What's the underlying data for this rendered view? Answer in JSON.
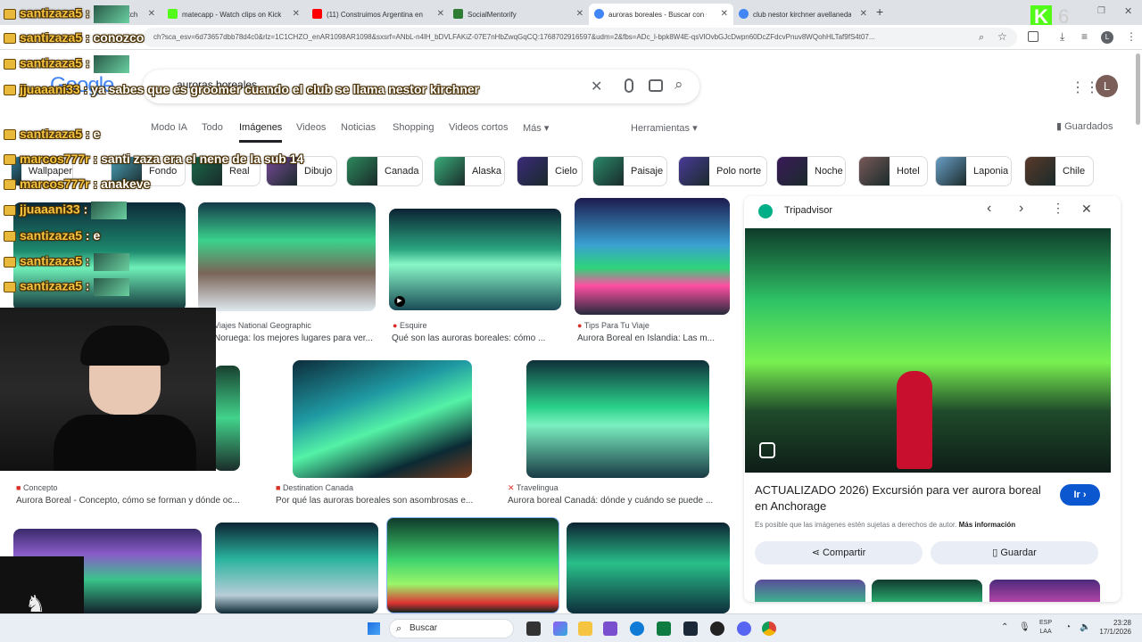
{
  "browser": {
    "tabs": [
      {
        "label": "Watch",
        "fav": "#ff9900",
        "active": false
      },
      {
        "label": "matecapp - Watch clips on Kick",
        "fav": "#53fc18",
        "active": false
      },
      {
        "label": "(11) Construimos Argentina en",
        "fav": "#ff0000",
        "active": false
      },
      {
        "label": "SocialMentorify",
        "fav": "#2e7d32",
        "active": false
      },
      {
        "label": "auroras boreales - Buscar con G",
        "fav": "#4285f4",
        "active": true
      },
      {
        "label": "club nestor kirchner avellaneda",
        "fav": "#4285f4",
        "active": false
      }
    ],
    "new_tab": "+",
    "url": "ch?sca_esv=6d73657dbb78d4c0&rlz=1C1CHZO_enAR1098AR1098&sxsrf=ANbL-n4lH_bDVLFAKiZ-07E7nHbZwqGqCQ:1768702916597&udm=2&fbs=ADc_l-bpk8W4E-qsVlOvbGJcDwpn60DcZFdcvPnuv8WQohHLTaf9fS4t07...",
    "kick_badge": "K",
    "kick_count": "6"
  },
  "search": {
    "logo": "Google",
    "query": "auroras boreales",
    "avatar_letter": "L",
    "nav": [
      {
        "label": "Modo IA",
        "active": false
      },
      {
        "label": "Todo",
        "active": false
      },
      {
        "label": "Imágenes",
        "active": true
      },
      {
        "label": "Videos",
        "active": false
      },
      {
        "label": "Noticias",
        "active": false
      },
      {
        "label": "Shopping",
        "active": false
      },
      {
        "label": "Videos cortos",
        "active": false
      },
      {
        "label": "Más ▾",
        "active": false
      }
    ],
    "tools": "Herramientas ▾",
    "saved": "Guardados",
    "chips": [
      "Wallpaper",
      "Fondo",
      "Real",
      "Dibujo",
      "Canada",
      "Alaska",
      "Cielo",
      "Paisaje",
      "Polo norte",
      "Noche",
      "Hotel",
      "Laponia",
      "Chile"
    ]
  },
  "results": [
    {
      "source": "Viajes National Geographic",
      "title": "Noruega: los mejores lugares para ver..."
    },
    {
      "source": "Esquire",
      "title": "Qué son las auroras boreales: cómo ..."
    },
    {
      "source": "Tips Para Tu Viaje",
      "title": "Aurora Boreal en Islandia: Las m..."
    },
    {
      "source": "Concepto",
      "title": "Aurora Boreal - Concepto, cómo se forman y dónde oc..."
    },
    {
      "source": "Destination Canada",
      "title": "Por qué las auroras boreales son asombrosas e..."
    },
    {
      "source": "Travelingua",
      "title": "Aurora boreal Canadá: dónde y cuándo se puede ..."
    }
  ],
  "panel": {
    "site": "Tripadvisor",
    "title": "ACTUALIZADO 2026) Excursión para ver aurora boreal en Anchorage",
    "go": "Ir ›",
    "notice": "Es posible que las imágenes estén sujetas a derechos de autor.",
    "more_info": "Más información",
    "share": "Compartir",
    "save": "Guardar"
  },
  "chat": [
    {
      "user": "santizaza5",
      "msg": ""
    },
    {
      "user": "santizaza5",
      "msg": "conozco"
    },
    {
      "user": "santizaza5",
      "msg": ""
    },
    {
      "user": "jjuaaani33",
      "msg": "ya sabes que es groomer cuando el club se llama nestor kirchner"
    },
    {
      "user": "santizaza5",
      "msg": "e"
    },
    {
      "user": "marcos777r",
      "msg": "santi zaza era el nene de la sub 14"
    },
    {
      "user": "marcos777r",
      "msg": "anakeve"
    },
    {
      "user": "jjuaaani33",
      "msg": ""
    },
    {
      "user": "santizaza5",
      "msg": "e"
    },
    {
      "user": "santizaza5",
      "msg": ""
    },
    {
      "user": "santizaza5",
      "msg": ""
    }
  ],
  "taskbar": {
    "search": "Buscar",
    "lang1": "ESP",
    "lang2": "LAA",
    "time": "23:28",
    "date": "17/1/2026"
  }
}
